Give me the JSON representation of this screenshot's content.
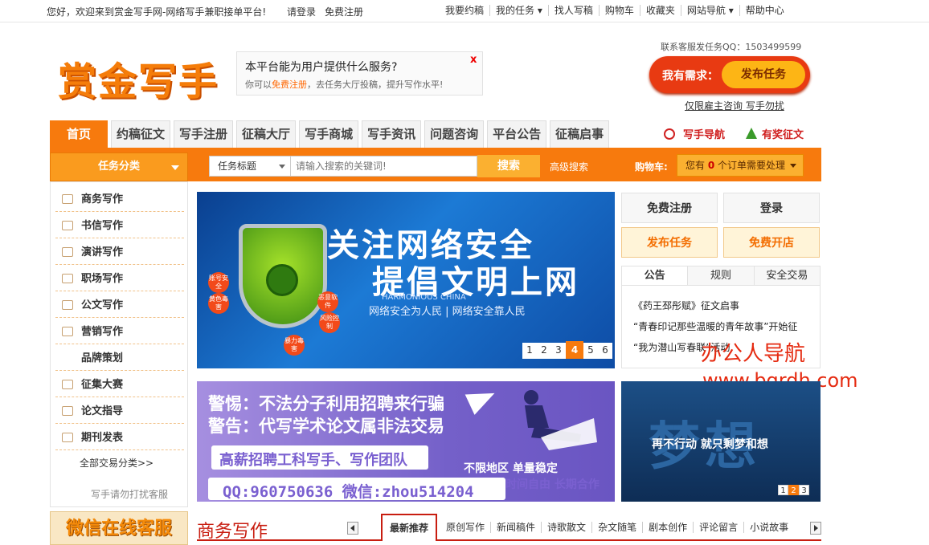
{
  "topbar": {
    "greeting": "您好，欢迎来到赏金写手网-网络写手兼职接单平台!",
    "login": "请登录",
    "register": "免费注册",
    "links": [
      "我要约稿",
      "我的任务 ▾",
      "找人写稿",
      "购物车",
      "收藏夹",
      "网站导航 ▾",
      "帮助中心"
    ]
  },
  "header": {
    "logo": "赏金写手",
    "promo_title": "本平台能为用户提供什么服务?",
    "promo_desc_pre": "你可以",
    "promo_desc_link": "免费注册",
    "promo_desc_post": "，去任务大厅投稿，提升写作水平!",
    "promo_close": "x",
    "qq_contact": "联系客服发任务QQ：1503499599",
    "need_label": "我有需求：",
    "publish_btn": "发布任务",
    "hire_link": "仅限雇主咨询 写手勿扰"
  },
  "nav": {
    "tabs": [
      "首页",
      "约稿征文",
      "写手注册",
      "征稿大厅",
      "写手商城",
      "写手资讯",
      "问题咨询",
      "平台公告",
      "征稿启事"
    ],
    "writer_nav": "写手导航",
    "prize": "有奖征文"
  },
  "search": {
    "category_btn": "任务分类",
    "select_value": "任务标题",
    "placeholder": "请输入搜索的关键词!",
    "search_btn": "搜索",
    "advanced": "高级搜索",
    "cart_label": "购物车:",
    "cart_pre": "您有",
    "cart_count": "0",
    "cart_post": "个订单需要处理"
  },
  "sidebar": {
    "items": [
      "商务写作",
      "书信写作",
      "演讲写作",
      "职场写作",
      "公文写作",
      "营销写作",
      "品牌策划",
      "征集大赛",
      "论文指导",
      "期刊发表"
    ],
    "all": "全部交易分类>>",
    "note": "写手请勿打扰客服"
  },
  "banner1": {
    "line1": "关注网络安全",
    "line2": "提倡文明上网",
    "en": "HARMONIOUS CHINA",
    "slogan": "网络安全为人民 | 网络安全靠人民",
    "badges": [
      "账号安全",
      "黄色毒害",
      "恶意软件",
      "风险控制",
      "暴力毒害"
    ],
    "pages": [
      "1",
      "2",
      "3",
      "4",
      "5",
      "6"
    ],
    "active_page": 4
  },
  "banner2": {
    "warn1": "警惕：不法分子利用招聘来行骗",
    "warn2": "警告：代写学术论文属非法交易",
    "recruit": "高薪招聘工科写手、写作团队",
    "region": "不限地区 单量稳定",
    "contact": "QQ:960750636 微信:zhou514204",
    "time": "时间自由 长期合作"
  },
  "right": {
    "free_register": "免费注册",
    "login": "登录",
    "publish": "发布任务",
    "open_shop": "免费开店",
    "tabs": [
      "公告",
      "规则",
      "安全交易"
    ],
    "notices": [
      "《药王邳彤赋》征文启事",
      "“青春印记那些温暖的青年故事”开始征",
      "“我为潜山写春联”活动"
    ]
  },
  "watermark": {
    "name": "办公人导航",
    "url": "www.bgrdh.com"
  },
  "banner3": {
    "big": "梦想",
    "sub": "再不行动 就只剩梦和想",
    "pages": [
      "1",
      "2",
      "3"
    ]
  },
  "bottom": {
    "wechat_service": "微信在线客服",
    "section_title": "商务写作",
    "tabs": [
      "最新推荐",
      "原创写作",
      "新闻稿件",
      "诗歌散文",
      "杂文随笔",
      "剧本创作",
      "评论留言",
      "小说故事"
    ]
  },
  "colors": {
    "brand_orange": "#f77a0d",
    "accent_red": "#c81d10",
    "watermark_red": "#e52a10"
  }
}
